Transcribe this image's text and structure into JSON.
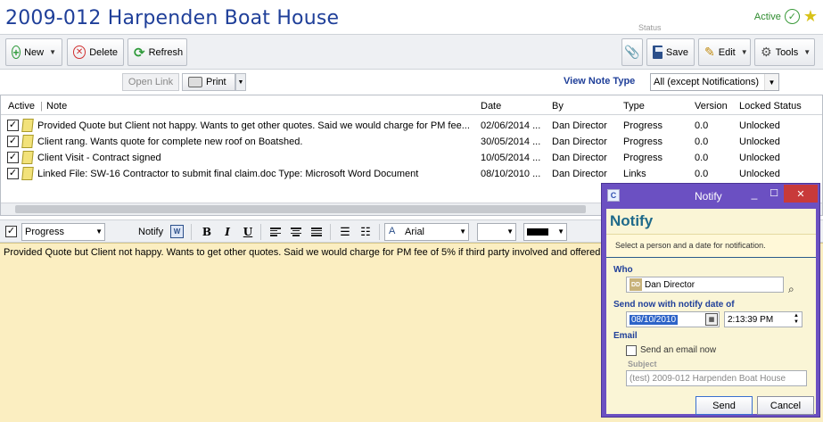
{
  "header": {
    "title": "2009-012 Harpenden Boat House",
    "status_caption": "Status",
    "status": "Active"
  },
  "toolbar": {
    "new_label": "New",
    "delete_label": "Delete",
    "refresh_label": "Refresh",
    "save_label": "Save",
    "edit_label": "Edit",
    "tools_label": "Tools"
  },
  "subbar": {
    "open_link_label": "Open Link",
    "print_label": "Print",
    "view_note_type_label": "View Note Type",
    "view_note_type_value": "All (except Notifications)"
  },
  "notes_table": {
    "columns": [
      "Active",
      "Note",
      "Date",
      "By",
      "Type",
      "Version",
      "Locked Status"
    ],
    "rows": [
      {
        "note": "Provided Quote but Client not happy.  Wants to get other quotes.  Said we would charge for PM fee...",
        "date": "02/06/2014 ...",
        "by": "Dan Director",
        "type": "Progress",
        "version": "0.0",
        "locked": "Unlocked"
      },
      {
        "note": "Client rang. Wants quote for complete new roof on Boatshed.",
        "date": "30/05/2014 ...",
        "by": "Dan Director",
        "type": "Progress",
        "version": "0.0",
        "locked": "Unlocked"
      },
      {
        "note": "Client Visit - Contract signed",
        "date": "10/05/2014 ...",
        "by": "Dan Director",
        "type": "Progress",
        "version": "0.0",
        "locked": "Unlocked"
      },
      {
        "note": "Linked File: SW-16 Contractor to submit final claim.doc Type: Microsoft Word Document",
        "date": "08/10/2010 ...",
        "by": "Dan Director",
        "type": "Links",
        "version": "0.0",
        "locked": "Unlocked"
      }
    ]
  },
  "format_bar": {
    "note_type": "Progress",
    "notify_label": "Notify",
    "font": "Arial"
  },
  "editor": {
    "text": "Provided Quote but Client not happy.  Wants to get other quotes.  Said we would charge for PM fee of 5% if third party involved and offered"
  },
  "notify_dialog": {
    "window_title": "Notify",
    "heading": "Notify",
    "hint": "Select a person and a date for notification.",
    "who_label": "Who",
    "who_value": "Dan Director",
    "who_initials": "DD",
    "send_now_label": "Send now with notify date of",
    "date_value": "08/10/2010",
    "time_value": "2:13:39 PM",
    "email_label": "Email",
    "send_email_label": "Send an email now",
    "subject_label": "Subject",
    "subject_value": "(test) 2009-012 Harpenden Boat House",
    "send_button": "Send",
    "cancel_button": "Cancel"
  }
}
